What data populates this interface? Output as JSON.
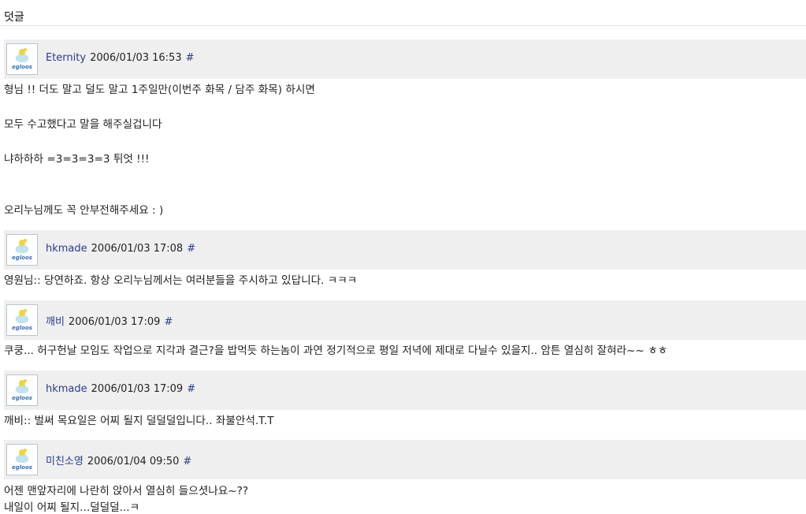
{
  "section_title": "덧글",
  "avatar_label": "egloos",
  "comments": [
    {
      "author": "Eternity",
      "date": "2006/01/03 16:53",
      "permalink": "#",
      "lines": [
        "형님 !! 더도 말고 덜도 말고 1주일만(이번주 화목 / 담주 화목) 하시면",
        "모두 수고했다고 말을 해주실겁니다",
        "냐하하하 =3=3=3=3 튀엇 !!!",
        "오리누님께도 꼭 안부전해주세요 : )"
      ]
    },
    {
      "author": "hkmade",
      "date": "2006/01/03 17:08",
      "permalink": "#",
      "lines": [
        "영원님:: 당연하죠. 항상 오리누님께서는 여러분들을 주시하고 있답니다. ㅋㅋㅋ"
      ]
    },
    {
      "author": "깨비",
      "date": "2006/01/03 17:09",
      "permalink": "#",
      "lines": [
        "쿠쿵... 허구헌날 모임도 작업으로 지각과 결근?을 밥먹듯 하는놈이 과연 정기적으로 평일 저녁에 제대로 다닐수 있을지.. 암튼 열심히 잘혀라~~ ㅎㅎ"
      ]
    },
    {
      "author": "hkmade",
      "date": "2006/01/03 17:09",
      "permalink": "#",
      "lines": [
        "깨비:: 벌써 목요일은 어찌 될지 덜덜덜입니다.. 좌불안석.T.T"
      ]
    },
    {
      "author": "미친소영",
      "date": "2006/01/04 09:50",
      "permalink": "#",
      "lines": [
        "어젠 맨앞자리에 나란히 앉아서 열심히 들으셧나요~??",
        "내일이 어찌 될지...덜덜덜...ㅋ"
      ]
    }
  ]
}
